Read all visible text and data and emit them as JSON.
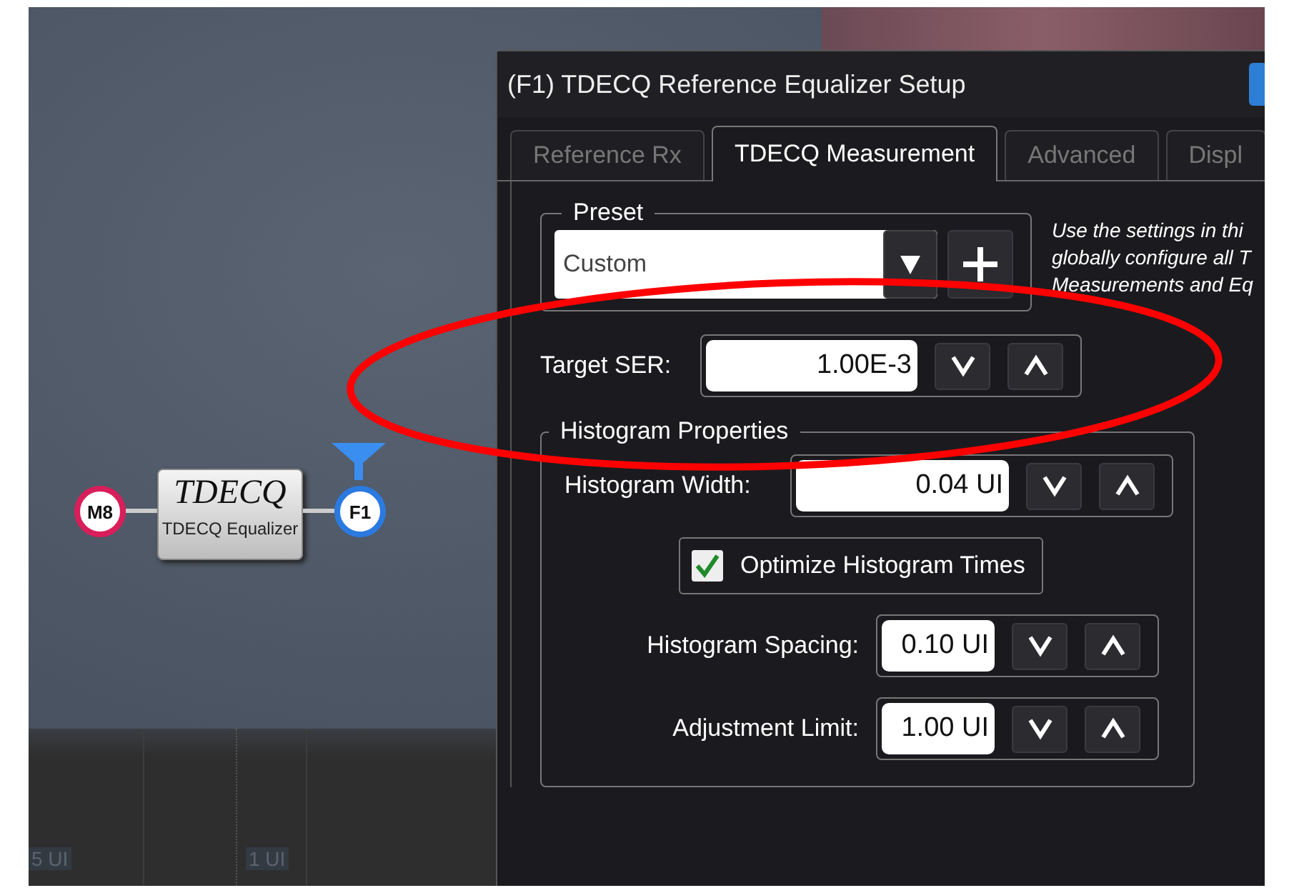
{
  "canvas": {
    "nodes": [
      {
        "kind": "source",
        "label": "M8"
      },
      {
        "kind": "block",
        "title": "TDECQ",
        "subtitle": "TDECQ Equalizer"
      },
      {
        "kind": "output",
        "label": "F1"
      }
    ],
    "axis_labels": [
      "5 UI",
      "1 UI"
    ]
  },
  "dialog": {
    "title": "(F1) TDECQ Reference Equalizer Setup",
    "tabs": [
      {
        "label": "Reference Rx",
        "selected": false
      },
      {
        "label": "TDECQ Measurement",
        "selected": true
      },
      {
        "label": "Advanced",
        "selected": false
      },
      {
        "label": "Displ",
        "selected": false
      }
    ],
    "preset": {
      "legend": "Preset",
      "value": "Custom"
    },
    "description_lines": [
      "Use the settings in thi",
      "globally configure all T",
      "Measurements and Eq"
    ],
    "target_ser": {
      "label": "Target SER:",
      "value": "1.00E-3"
    },
    "histogram": {
      "legend": "Histogram Properties",
      "width": {
        "label": "Histogram Width:",
        "value": "0.04 UI"
      },
      "optimize": {
        "label": "Optimize Histogram Times",
        "checked": true
      },
      "spacing": {
        "label": "Histogram Spacing:",
        "value": "0.10 UI"
      },
      "limit": {
        "label": "Adjustment Limit:",
        "value": "1.00 UI"
      }
    }
  }
}
